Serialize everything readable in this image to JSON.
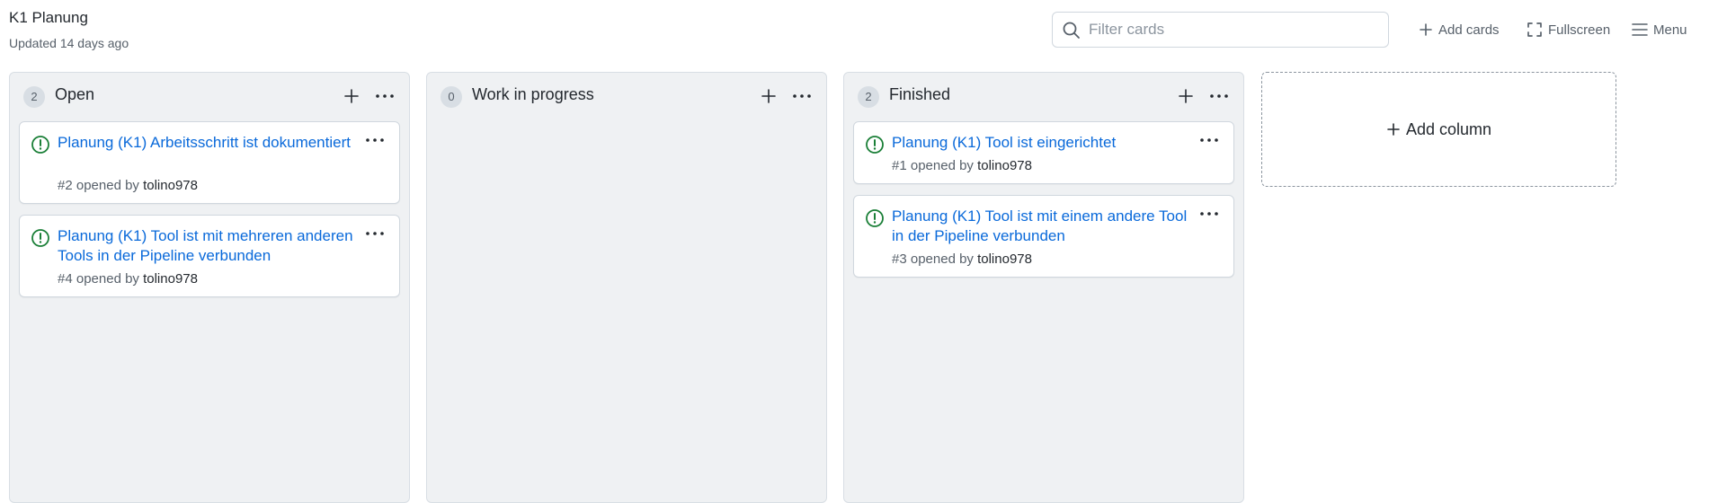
{
  "header": {
    "title": "K1 Planung",
    "updated": "Updated 14 days ago",
    "filter_placeholder": "Filter cards",
    "add_cards": "Add cards",
    "fullscreen": "Fullscreen",
    "menu": "Menu"
  },
  "columns": [
    {
      "count": "2",
      "name": "Open",
      "cards": [
        {
          "title": "Planung (K1) Arbeitsschritt ist dokumentiert",
          "meta_prefix": "#2 opened by ",
          "user": "tolino978"
        },
        {
          "title": "Planung (K1) Tool ist mit mehreren anderen Tools in der Pipeline verbunden",
          "meta_prefix": "#4 opened by ",
          "user": "tolino978"
        }
      ]
    },
    {
      "count": "0",
      "name": "Work in progress",
      "cards": []
    },
    {
      "count": "2",
      "name": "Finished",
      "cards": [
        {
          "title": "Planung (K1) Tool ist eingerichtet",
          "meta_prefix": "#1 opened by ",
          "user": "tolino978"
        },
        {
          "title": "Planung (K1) Tool ist mit einem andere Tool in der Pipeline verbunden",
          "meta_prefix": "#3 opened by ",
          "user": "tolino978"
        }
      ]
    }
  ],
  "add_column": "Add column",
  "colors": {
    "link": "#0969da",
    "open_issue": "#1a7f37",
    "column_bg": "#eff1f3"
  }
}
